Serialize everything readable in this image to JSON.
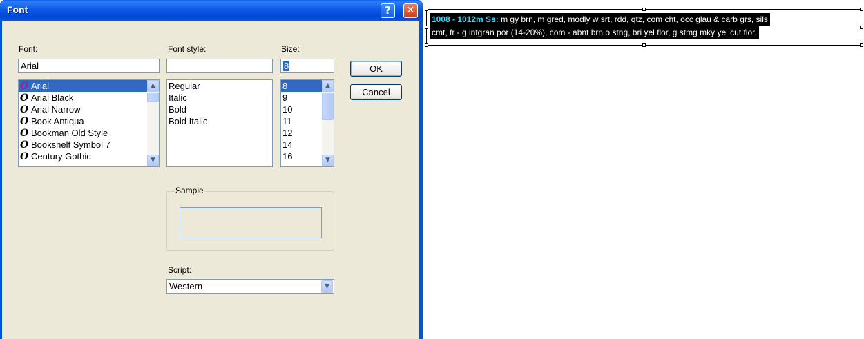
{
  "dialog": {
    "title": "Font",
    "help_icon": "question-icon",
    "close_icon": "close-icon",
    "font_label": "Font:",
    "font_value": "Arial",
    "font_list": [
      "Arial",
      "Arial Black",
      "Arial Narrow",
      "Book Antiqua",
      "Bookman Old Style",
      "Bookshelf Symbol 7",
      "Century Gothic"
    ],
    "font_selected_index": 0,
    "style_label": "Font style:",
    "style_value": "",
    "style_list": [
      "Regular",
      "Italic",
      "Bold",
      "Bold Italic"
    ],
    "size_label": "Size:",
    "size_value": "8",
    "size_list": [
      "8",
      "9",
      "10",
      "11",
      "12",
      "14",
      "16"
    ],
    "size_selected_index": 0,
    "ok_label": "OK",
    "cancel_label": "Cancel",
    "sample_label": "Sample",
    "script_label": "Script:",
    "script_value": "Western"
  },
  "annotation": {
    "header": "1008 - 1012m Ss:",
    "line1_rest": " m gy brn, m gred, modly w srt, rdd, qtz, com cht, occ glau & carb grs, sils",
    "line2": "cmt, fr - g intgran por (14-20%), com - abnt brn o stng, bri yel flor, g stmg mky yel cut flor."
  },
  "colors": {
    "titlebar": "#0054e3",
    "selection": "#316ac5",
    "dialog_bg": "#ece9d8",
    "annotation_header": "#38d8f2"
  }
}
